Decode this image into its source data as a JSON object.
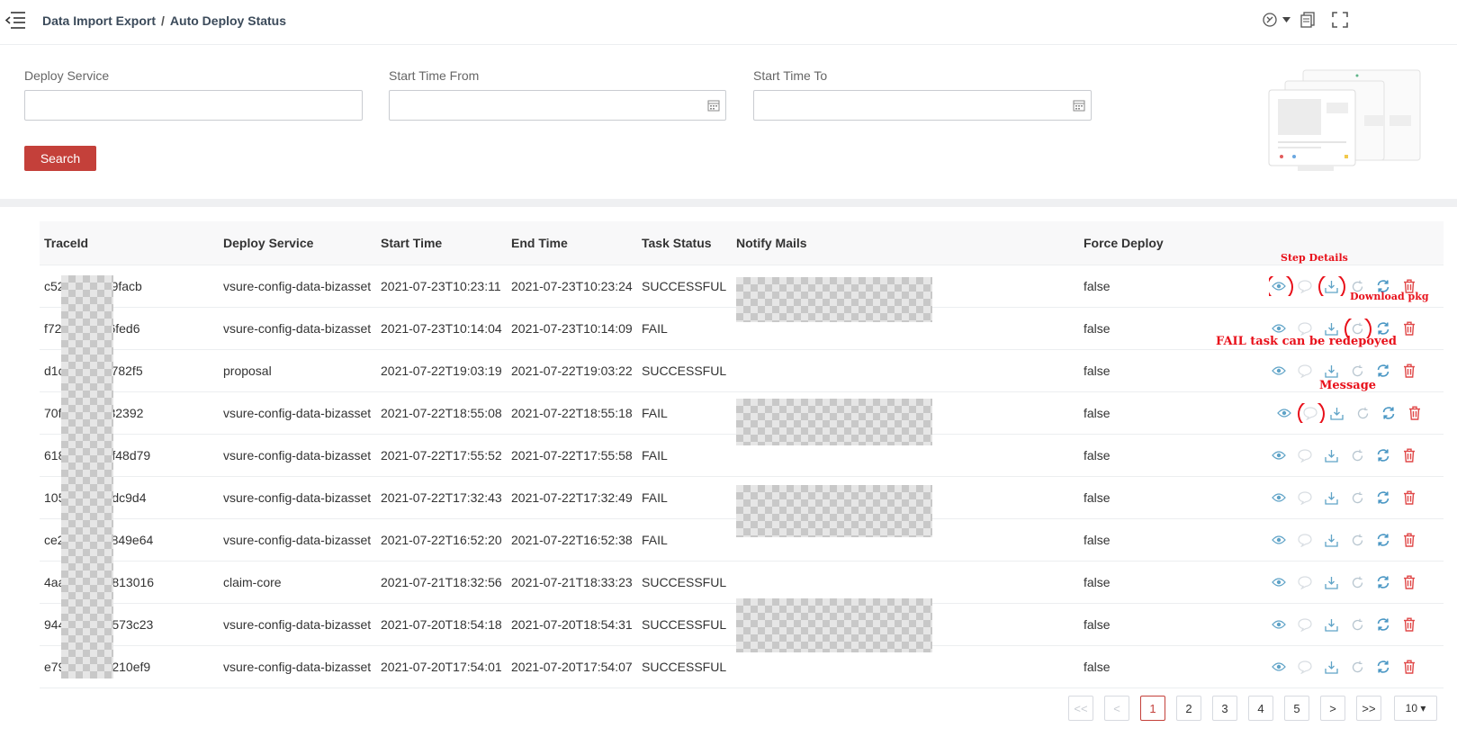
{
  "breadcrumb": {
    "parent": "Data Import Export",
    "separator": "/",
    "current": "Auto Deploy Status"
  },
  "header_icons": [
    "theme-icon",
    "chevron-down-icon",
    "document-icon",
    "fullscreen-icon"
  ],
  "filters": {
    "deploy_service": {
      "label": "Deploy Service",
      "value": "",
      "placeholder": ""
    },
    "start_time_from": {
      "label": "Start Time From",
      "value": "",
      "placeholder": ""
    },
    "start_time_to": {
      "label": "Start Time To",
      "value": "",
      "placeholder": ""
    },
    "search_label": "Search"
  },
  "table": {
    "columns": [
      "TraceId",
      "Deploy Service",
      "Start Time",
      "End Time",
      "Task Status",
      "Notify Mails",
      "Force Deploy"
    ],
    "rows": [
      {
        "trace_prefix": "c52",
        "trace_suffix": "9facb",
        "service": "vsure-config-data-bizasset",
        "start": "2021-07-23T10:23:11",
        "end": "2021-07-23T10:23:24",
        "status": "SUCCESSFUL",
        "force": "false"
      },
      {
        "trace_prefix": "f72",
        "trace_suffix": "6fed6",
        "service": "vsure-config-data-bizasset",
        "start": "2021-07-23T10:14:04",
        "end": "2021-07-23T10:14:09",
        "status": "FAIL",
        "force": "false"
      },
      {
        "trace_prefix": "d1c",
        "trace_suffix": "782f5",
        "service": "proposal",
        "start": "2021-07-22T19:03:19",
        "end": "2021-07-22T19:03:22",
        "status": "SUCCESSFUL",
        "force": "false"
      },
      {
        "trace_prefix": "70f",
        "trace_suffix": "32392",
        "service": "vsure-config-data-bizasset",
        "start": "2021-07-22T18:55:08",
        "end": "2021-07-22T18:55:18",
        "status": "FAIL",
        "force": "false"
      },
      {
        "trace_prefix": "618",
        "trace_suffix": "f48d79",
        "service": "vsure-config-data-bizasset",
        "start": "2021-07-22T17:55:52",
        "end": "2021-07-22T17:55:58",
        "status": "FAIL",
        "force": "false"
      },
      {
        "trace_prefix": "105",
        "trace_suffix": "dc9d4",
        "service": "vsure-config-data-bizasset",
        "start": "2021-07-22T17:32:43",
        "end": "2021-07-22T17:32:49",
        "status": "FAIL",
        "force": "false"
      },
      {
        "trace_prefix": "ce2",
        "trace_suffix": "849e64",
        "service": "vsure-config-data-bizasset",
        "start": "2021-07-22T16:52:20",
        "end": "2021-07-22T16:52:38",
        "status": "FAIL",
        "force": "false"
      },
      {
        "trace_prefix": "4aa",
        "trace_suffix": "813016",
        "service": "claim-core",
        "start": "2021-07-21T18:32:56",
        "end": "2021-07-21T18:33:23",
        "status": "SUCCESSFUL",
        "force": "false"
      },
      {
        "trace_prefix": "944",
        "trace_suffix": "573c23",
        "service": "vsure-config-data-bizasset",
        "start": "2021-07-20T18:54:18",
        "end": "2021-07-20T18:54:31",
        "status": "SUCCESSFUL",
        "force": "false"
      },
      {
        "trace_prefix": "e79",
        "trace_suffix": "210ef9",
        "service": "vsure-config-data-bizasset",
        "start": "2021-07-20T17:54:01",
        "end": "2021-07-20T17:54:07",
        "status": "SUCCESSFUL",
        "force": "false"
      }
    ],
    "row_action_icons": [
      "eye-icon",
      "message-icon",
      "download-icon",
      "redeploy-icon",
      "refresh-icon",
      "delete-icon"
    ]
  },
  "annotations": {
    "step_details": "Step Details",
    "download_pkg": "Download pkg",
    "fail_redeploy": "FAIL task can be redepoyed",
    "message": "Message"
  },
  "pagination": {
    "first": "<<",
    "prev": "<",
    "pages": [
      "1",
      "2",
      "3",
      "4",
      "5"
    ],
    "current": "1",
    "next": ">",
    "last": ">>",
    "page_size": "10 ▾"
  },
  "colors": {
    "primary_red": "#c4403a",
    "annotation_red": "#e8101a",
    "action_blue": "#5fa3c7",
    "delete_red": "#e04848"
  }
}
